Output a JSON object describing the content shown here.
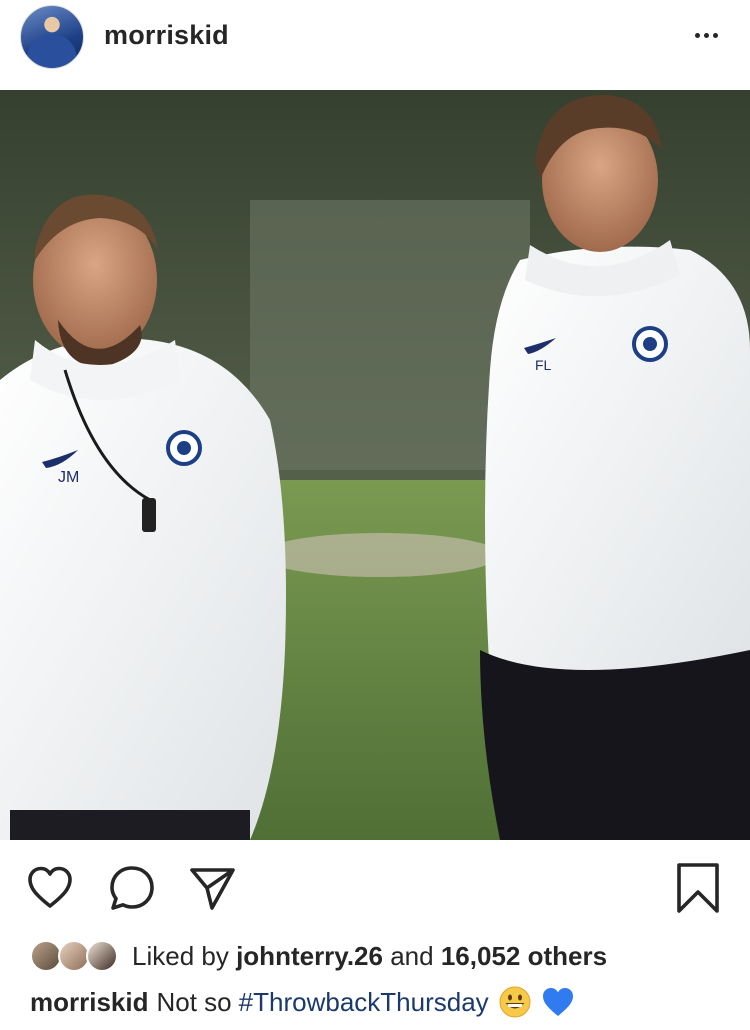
{
  "post": {
    "username": "morriskid",
    "more_icon": "more-horizontal-icon",
    "photo": {
      "left_jacket_initials": "JM",
      "right_jacket_initials": "FL"
    }
  },
  "actions": {
    "like_icon": "heart-icon",
    "comment_icon": "comment-bubble-icon",
    "share_icon": "paper-plane-icon",
    "save_icon": "bookmark-icon"
  },
  "likes": {
    "prefix": "Liked by",
    "first_liker": "johnterry.26",
    "connector": "and",
    "others": "16,052 others"
  },
  "caption": {
    "username": "morriskid",
    "text": "Not so",
    "hashtag": "#ThrowbackThursday",
    "emojis": [
      "grinning-face-emoji",
      "blue-heart-emoji"
    ]
  },
  "colors": {
    "text": "#262626",
    "hashtag": "#1a3a6e",
    "heart_blue": "#2f7bef"
  }
}
